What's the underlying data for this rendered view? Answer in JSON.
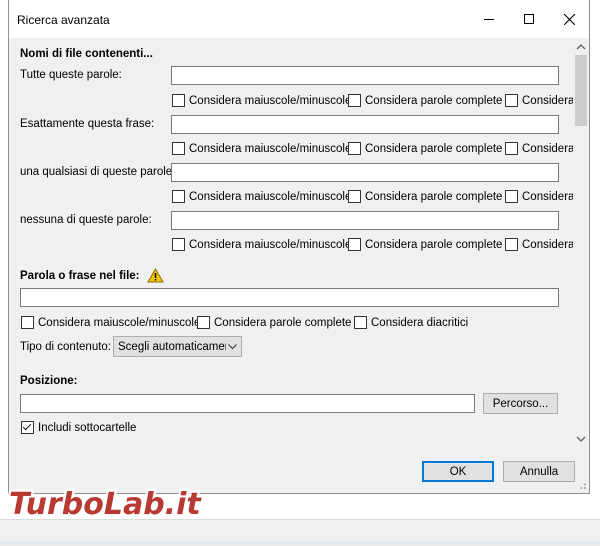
{
  "window": {
    "title": "Ricerca avanzata"
  },
  "filename_section": {
    "heading": "Nomi di file contenenti...",
    "rows": [
      {
        "label": "Tutte queste parole:",
        "value": ""
      },
      {
        "label": "Esattamente questa frase:",
        "value": ""
      },
      {
        "label": "una qualsiasi di queste parole:",
        "value": ""
      },
      {
        "label": "nessuna di queste parole:",
        "value": ""
      }
    ],
    "options": [
      "Considera maiuscole/minuscole",
      "Considera parole complete",
      "Considera"
    ]
  },
  "content_section": {
    "heading": "Parola o frase nel file:",
    "value": "",
    "options": [
      "Considera maiuscole/minuscole",
      "Considera parole complete",
      "Considera diacritici"
    ],
    "content_type_label": "Tipo di contenuto:",
    "content_type_value": "Scegli automaticamente"
  },
  "position_section": {
    "heading": "Posizione:",
    "value": "",
    "browse_label": "Percorso...",
    "subfolders_label": "Includi sottocartelle",
    "subfolders_checked": true
  },
  "footer": {
    "ok_label": "OK",
    "cancel_label": "Annulla"
  },
  "watermark": {
    "text": "TurboLab.it"
  },
  "colors": {
    "accent": "#0078d7",
    "warning": "#f5c400",
    "watermark": "#b22a22"
  },
  "icons": [
    "minimize-icon",
    "maximize-icon",
    "close-icon",
    "warning-icon",
    "chevron-down-icon",
    "scroll-up-icon",
    "scroll-down-icon",
    "checkmark-icon"
  ]
}
